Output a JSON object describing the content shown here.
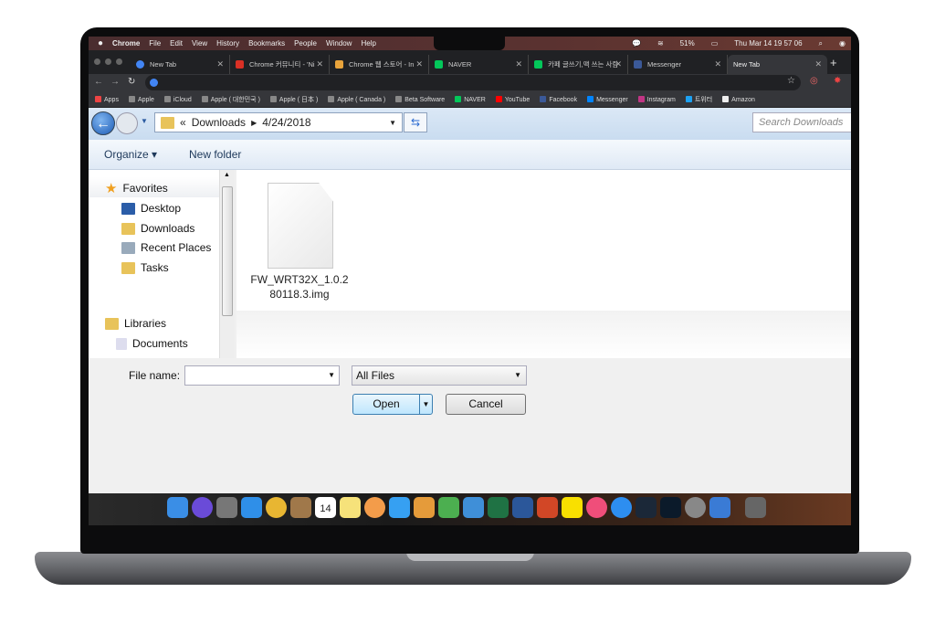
{
  "menubar": {
    "items": [
      "Chrome",
      "File",
      "Edit",
      "View",
      "History",
      "Bookmarks",
      "People",
      "Window",
      "Help"
    ],
    "battery": "51%",
    "clock": "Thu Mar 14  19 57 06"
  },
  "tabs": [
    {
      "label": "New Tab",
      "color": "#4285f4"
    },
    {
      "label": "Chrome 커뮤니티 - 'Ni",
      "color": "#d93025"
    },
    {
      "label": "Chrome 웹 스토어 - In",
      "color": "#e8a33b"
    },
    {
      "label": "NAVER",
      "color": "#03c75a"
    },
    {
      "label": "카페 글쓰기,맥 쓰는 사람",
      "color": "#03c75a"
    },
    {
      "label": "Messenger",
      "color": "#3b5998"
    },
    {
      "label": "New Tab",
      "color": "",
      "active": true
    }
  ],
  "bookmarks": [
    {
      "label": "Apps",
      "color": "#e44"
    },
    {
      "label": "Apple",
      "color": "#888"
    },
    {
      "label": "iCloud",
      "color": "#888"
    },
    {
      "label": "Apple ( 대한민국 )",
      "color": "#888"
    },
    {
      "label": "Apple ( 日本 )",
      "color": "#888"
    },
    {
      "label": "Apple ( Canada )",
      "color": "#888"
    },
    {
      "label": "Beta Software",
      "color": "#888"
    },
    {
      "label": "NAVER",
      "color": "#03c75a"
    },
    {
      "label": "YouTube",
      "color": "#f00"
    },
    {
      "label": "Facebook",
      "color": "#3b5998"
    },
    {
      "label": "Messenger",
      "color": "#0084ff"
    },
    {
      "label": "Instagram",
      "color": "#c13584"
    },
    {
      "label": "트위터",
      "color": "#1da1f2"
    },
    {
      "label": "Amazon",
      "color": "#eee"
    }
  ],
  "dialog": {
    "path": [
      "Downloads",
      "4/24/2018"
    ],
    "search_placeholder": "Search Downloads",
    "organize": "Organize",
    "new_folder": "New folder",
    "nav": {
      "favorites": "Favorites",
      "items": [
        "Desktop",
        "Downloads",
        "Recent Places",
        "Tasks"
      ],
      "libraries": "Libraries",
      "lib_items": [
        "Documents"
      ]
    },
    "file": {
      "name_line1": "FW_WRT32X_1.0.2",
      "name_line2": "80118.3.img"
    },
    "filename_label": "File name:",
    "filename_value": "",
    "filter": "All Files",
    "open": "Open",
    "cancel": "Cancel"
  },
  "dock": {
    "icons": [
      "finder",
      "siri",
      "launchpad",
      "safari",
      "chrome",
      "contacts",
      "calendar",
      "notes",
      "photos",
      "messages",
      "pages",
      "numbers",
      "keynote",
      "excel",
      "word",
      "powerpoint",
      "kakaotalk",
      "itunes",
      "app-store",
      "steam",
      "battle-net",
      "system-preferences",
      "parallels",
      "trash"
    ],
    "calendar_day": "14"
  }
}
